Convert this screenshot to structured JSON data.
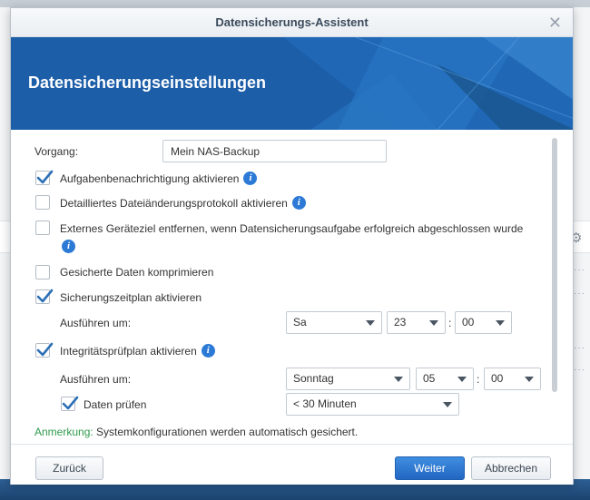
{
  "dialog": {
    "title": "Datensicherungs-Assistent",
    "close_icon": "close-icon",
    "banner_title": "Datensicherungseinstellungen"
  },
  "form": {
    "vorgang_label": "Vorgang:",
    "vorgang_value": "Mein NAS-Backup",
    "checkboxes": [
      {
        "label": "Aufgabenbenachrichtigung aktivieren",
        "checked": true,
        "info": true
      },
      {
        "label": "Detailliertes Dateiänderungsprotokoll aktivieren",
        "checked": false,
        "info": true
      },
      {
        "label": "Externes Geräteziel entfernen, wenn Datensicherungsaufgabe erfolgreich abgeschlossen wurde",
        "checked": false,
        "info": true
      },
      {
        "label": "Gesicherte Daten komprimieren",
        "checked": false,
        "info": false
      },
      {
        "label": "Sicherungszeitplan aktivieren",
        "checked": true,
        "info": false
      },
      {
        "label": "Integritätsprüfplan aktivieren",
        "checked": true,
        "info": true
      }
    ],
    "schedule": {
      "run_label": "Ausführen um:",
      "day": "Sa",
      "hour": "23",
      "minute": "00"
    },
    "integrity": {
      "run_label": "Ausführen um:",
      "day": "Sonntag",
      "hour": "05",
      "minute": "00",
      "check_label": "Daten prüfen",
      "check_checked": true,
      "duration": "< 30 Minuten"
    },
    "time_separator": ":",
    "note_key": "Anmerkung:",
    "note_text": "Systemkonfigurationen werden automatisch gesichert."
  },
  "footer": {
    "back_label": "Zurück",
    "next_label": "Weiter",
    "cancel_label": "Abbrechen"
  },
  "colors": {
    "accent": "#2c7ad6",
    "banner": "#1d5ea8",
    "note_key": "#2f9a4c"
  }
}
